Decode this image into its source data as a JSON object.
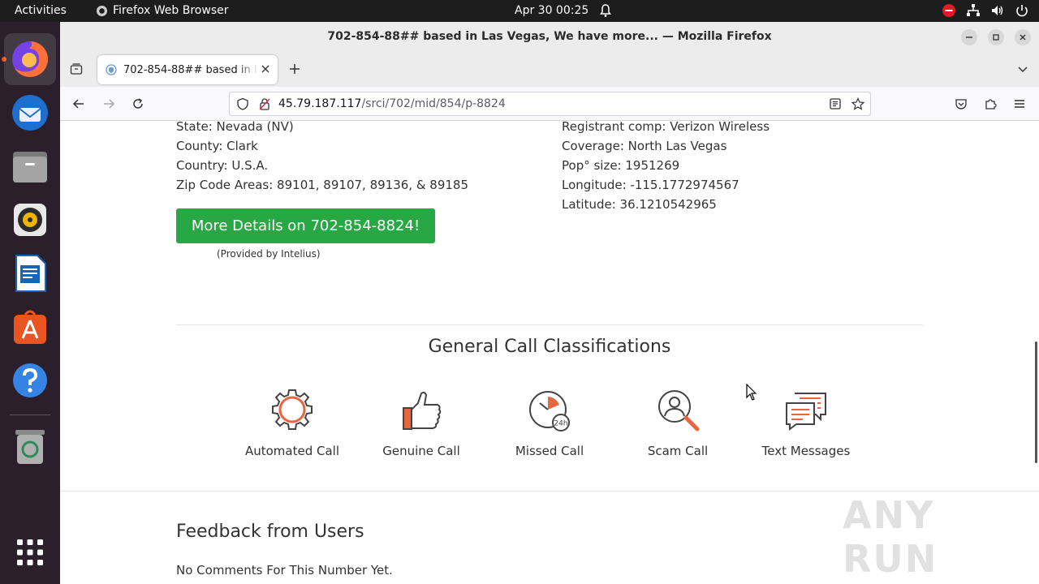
{
  "topbar": {
    "activities": "Activities",
    "app_name": "Firefox Web Browser",
    "clock": "Apr 30  00:25"
  },
  "window": {
    "title": "702-854-88## based in Las Vegas, We have more... — Mozilla Firefox"
  },
  "tab": {
    "label": "702-854-88## based in Las Vegas"
  },
  "url": {
    "host": "45.79.187.117",
    "path": "/srci/702/mid/854/p-8824"
  },
  "info_left": [
    "State: Nevada (NV)",
    "County: Clark",
    "Country: U.S.A.",
    "Zip Code Areas: 89101, 89107, 89136, & 89185"
  ],
  "info_right": [
    "Registrant comp: Verizon Wireless",
    "Coverage: North Las Vegas",
    "Pop° size: 1951269",
    "Longitude: -115.1772974567",
    "Latitude: 36.1210542965"
  ],
  "details_button": "More Details on 702-854-8824!",
  "provided_by": "(Provided by Intelius)",
  "classifications": {
    "title": "General Call Classifications",
    "items": [
      "Automated Call",
      "Genuine Call",
      "Missed Call",
      "Scam Call",
      "Text Messages"
    ]
  },
  "feedback": {
    "title": "Feedback from Users",
    "empty": "No Comments For This Number Yet."
  },
  "watermark": "ANY RUN",
  "colors": {
    "accent_green": "#28a745",
    "icon_orange": "#e8663d",
    "icon_dark": "#444444"
  }
}
